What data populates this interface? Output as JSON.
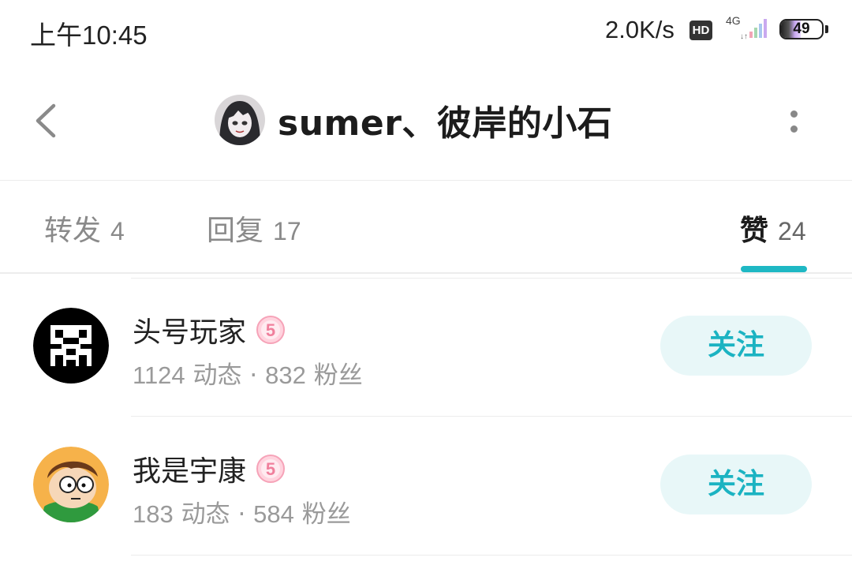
{
  "status_bar": {
    "time": "上午10:45",
    "net_speed": "2.0K/s",
    "hd_badge": "HD",
    "network_type": "4G",
    "battery_level": "49",
    "battery_percent": 49
  },
  "header": {
    "title": "sumer、彼岸的小石",
    "back_icon": "chevron-left-icon",
    "more_icon": "vertical-dots-icon"
  },
  "tabs": [
    {
      "label": "转发",
      "count": "4",
      "active": false
    },
    {
      "label": "回复",
      "count": "17",
      "active": false
    },
    {
      "label": "赞",
      "count": "24",
      "active": true
    }
  ],
  "accent_color": "#1fb8c4",
  "users": [
    {
      "name": "头号玩家",
      "level": "5",
      "posts": "1124",
      "posts_label": "动态",
      "fans": "832",
      "fans_label": "粉丝",
      "separator": "·",
      "follow_label": "关注"
    },
    {
      "name": "我是宇康",
      "level": "5",
      "posts": "183",
      "posts_label": "动态",
      "fans": "584",
      "fans_label": "粉丝",
      "separator": "·",
      "follow_label": "关注"
    }
  ]
}
